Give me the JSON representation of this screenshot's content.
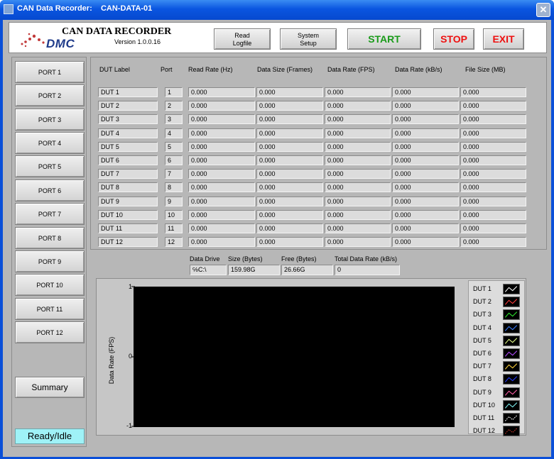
{
  "window": {
    "title": "CAN Data Recorder:    CAN-DATA-01"
  },
  "header": {
    "logo_text": "DMC",
    "app_title": "CAN DATA RECORDER",
    "version": "Version 1.0.0.16",
    "buttons": {
      "read_logfile_line1": "Read",
      "read_logfile_line2": "Logfile",
      "system_setup_line1": "System",
      "system_setup_line2": "Setup",
      "start": "START",
      "stop": "STOP",
      "exit": "EXIT"
    },
    "colors": {
      "start": "#1a9b1a",
      "stop": "#ee1111",
      "exit": "#ee1111"
    }
  },
  "ports": [
    "PORT 1",
    "PORT 2",
    "PORT 3",
    "PORT 4",
    "PORT 5",
    "PORT 6",
    "PORT 7",
    "PORT 8",
    "PORT 9",
    "PORT 10",
    "PORT 11",
    "PORT 12"
  ],
  "summary_label": "Summary",
  "status": "Ready/Idle",
  "table": {
    "columns": [
      "DUT Label",
      "Port",
      "Read Rate (Hz)",
      "Data Size (Frames)",
      "Data Rate (FPS)",
      "Data Rate (kB/s)",
      "File Size (MB)"
    ],
    "rows": [
      [
        "DUT 1",
        "1",
        "0.000",
        "0.000",
        "0.000",
        "0.000",
        "0.000"
      ],
      [
        "DUT 2",
        "2",
        "0.000",
        "0.000",
        "0.000",
        "0.000",
        "0.000"
      ],
      [
        "DUT 3",
        "3",
        "0.000",
        "0.000",
        "0.000",
        "0.000",
        "0.000"
      ],
      [
        "DUT 4",
        "4",
        "0.000",
        "0.000",
        "0.000",
        "0.000",
        "0.000"
      ],
      [
        "DUT 5",
        "5",
        "0.000",
        "0.000",
        "0.000",
        "0.000",
        "0.000"
      ],
      [
        "DUT 6",
        "6",
        "0.000",
        "0.000",
        "0.000",
        "0.000",
        "0.000"
      ],
      [
        "DUT 7",
        "7",
        "0.000",
        "0.000",
        "0.000",
        "0.000",
        "0.000"
      ],
      [
        "DUT 8",
        "8",
        "0.000",
        "0.000",
        "0.000",
        "0.000",
        "0.000"
      ],
      [
        "DUT 9",
        "9",
        "0.000",
        "0.000",
        "0.000",
        "0.000",
        "0.000"
      ],
      [
        "DUT 10",
        "10",
        "0.000",
        "0.000",
        "0.000",
        "0.000",
        "0.000"
      ],
      [
        "DUT 11",
        "11",
        "0.000",
        "0.000",
        "0.000",
        "0.000",
        "0.000"
      ],
      [
        "DUT 12",
        "12",
        "0.000",
        "0.000",
        "0.000",
        "0.000",
        "0.000"
      ]
    ]
  },
  "drive": {
    "drive_label": "Data Drive",
    "drive_value": "C:\\",
    "size_label": "Size (Bytes)",
    "size_value": "159.98G",
    "free_label": "Free (Bytes)",
    "free_value": "26.66G",
    "total_rate_label": "Total Data Rate (kB/s)",
    "total_rate_value": "0"
  },
  "chart_data": {
    "type": "line",
    "ylabel": "Data Rate (FPS)",
    "xlabel": "",
    "ylim": [
      -1,
      1
    ],
    "yticks": [
      "1",
      "0",
      "-1"
    ],
    "series": [
      {
        "name": "DUT 1",
        "color": "#ffffff"
      },
      {
        "name": "DUT 2",
        "color": "#ff3b3b"
      },
      {
        "name": "DUT 3",
        "color": "#2ee82e"
      },
      {
        "name": "DUT 4",
        "color": "#3a7dff"
      },
      {
        "name": "DUT 5",
        "color": "#e6ff8a"
      },
      {
        "name": "DUT 6",
        "color": "#b24cff"
      },
      {
        "name": "DUT 7",
        "color": "#ffd23a"
      },
      {
        "name": "DUT 8",
        "color": "#2a3dff"
      },
      {
        "name": "DUT 9",
        "color": "#ff5fa8"
      },
      {
        "name": "DUT 10",
        "color": "#7ff2f2"
      },
      {
        "name": "DUT 11",
        "color": "#ffffff"
      },
      {
        "name": "DUT 12",
        "color": "#c0392b"
      }
    ]
  }
}
